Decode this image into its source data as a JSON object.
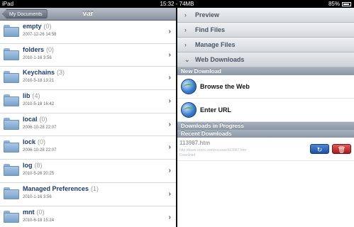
{
  "statusbar": {
    "device": "iPad",
    "time": "15:32 - 74MB",
    "battery": "85%"
  },
  "left": {
    "back_label": "My Documents",
    "title": "var",
    "folders": [
      {
        "name": "empty",
        "count": "(0)",
        "date": "2007-12-26 14:58"
      },
      {
        "name": "folders",
        "count": "(0)",
        "date": "2010-1-16 3:56"
      },
      {
        "name": "Keychains",
        "count": "(3)",
        "date": "2010-5-18 13:21"
      },
      {
        "name": "lib",
        "count": "(4)",
        "date": "2010-5-18 16:42"
      },
      {
        "name": "local",
        "count": "(0)",
        "date": "2006-10-28 22:07"
      },
      {
        "name": "lock",
        "count": "(0)",
        "date": "2006-10-28 22:07"
      },
      {
        "name": "log",
        "count": "(8)",
        "date": "2010-5-26 20:25"
      },
      {
        "name": "Managed Preferences",
        "count": "(1)",
        "date": "2010-1-16 3:56"
      },
      {
        "name": "mnt",
        "count": "(0)",
        "date": "2010-6-18 15:24"
      }
    ]
  },
  "right": {
    "sections": [
      {
        "label": "Preview",
        "arrow": "›"
      },
      {
        "label": "Find Files",
        "arrow": "›"
      },
      {
        "label": "Manage Files",
        "arrow": "›"
      },
      {
        "label": "Web Downloads",
        "arrow": "⌄"
      }
    ],
    "new_download_header": "New Download",
    "browse_label": "Browse the Web",
    "enter_url_label": "Enter URL",
    "in_progress_header": "Downloads in Progress",
    "recent_header": "Recent Downloads",
    "recent": {
      "name": "113987.htm",
      "url": "http://www.xxxxx.com/xxxxxxx/113987.htm",
      "status": "Download"
    }
  },
  "icons": {
    "chevron": "›",
    "refresh": "↻",
    "trash": "🗑"
  }
}
